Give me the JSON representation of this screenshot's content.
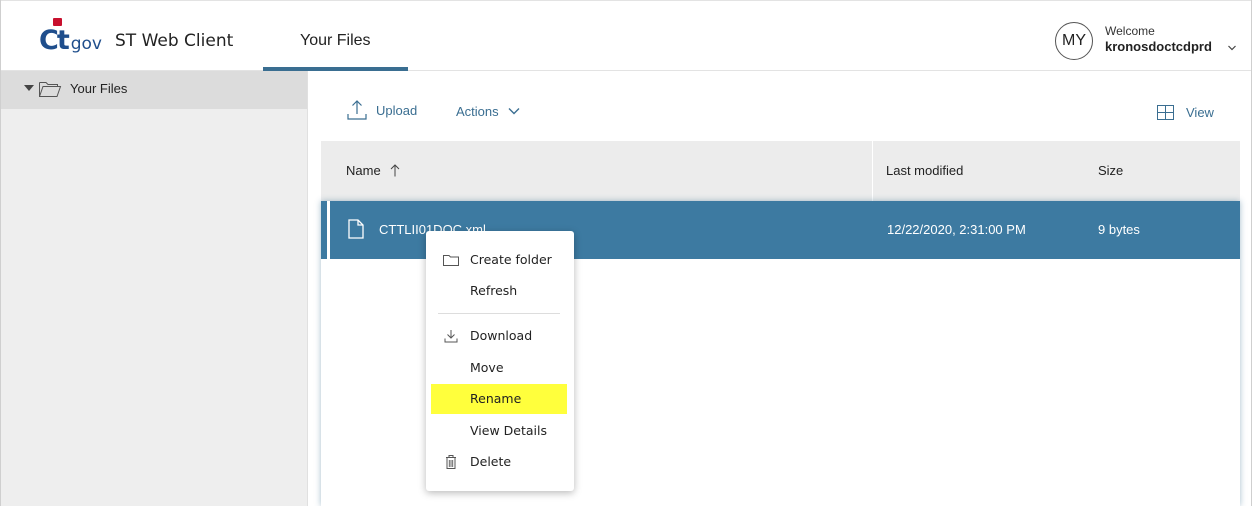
{
  "header": {
    "logo_ct": "Ct",
    "logo_gov": "gov",
    "app_title": "ST Web Client",
    "tab_label": "Your Files",
    "avatar_initials": "MY",
    "welcome_text": "Welcome",
    "username": "kronosdoctcdprd"
  },
  "sidebar": {
    "tree_root_label": "Your Files"
  },
  "toolbar": {
    "upload_label": "Upload",
    "actions_label": "Actions",
    "view_label": "View"
  },
  "table": {
    "columns": {
      "name": "Name",
      "modified": "Last modified",
      "size": "Size"
    },
    "rows": [
      {
        "name": "CTTLII01DOC.xml",
        "modified": "12/22/2020, 2:31:00 PM",
        "size": "9 bytes"
      }
    ]
  },
  "context_menu": {
    "items": [
      {
        "label": "Create folder",
        "icon": "folder-icon"
      },
      {
        "label": "Refresh",
        "icon": ""
      },
      {
        "label": "Download",
        "icon": "download-icon"
      },
      {
        "label": "Move",
        "icon": ""
      },
      {
        "label": "Rename",
        "icon": "",
        "highlighted": true
      },
      {
        "label": "View Details",
        "icon": ""
      },
      {
        "label": "Delete",
        "icon": "trash-icon"
      }
    ]
  },
  "colors": {
    "accent": "#3a6e91",
    "selected_row": "#3d7aa1",
    "highlight": "#ffff3c"
  }
}
